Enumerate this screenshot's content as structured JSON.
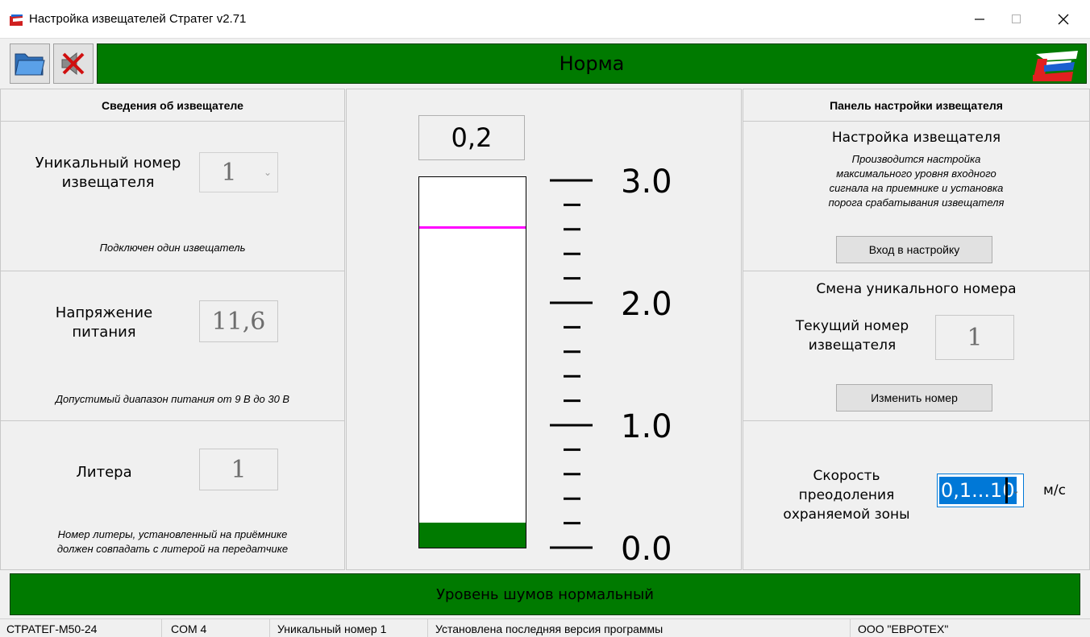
{
  "window": {
    "title": "Настройка извещателей Стратег v2.71"
  },
  "toolbar": {
    "status": "Норма",
    "status_color": "#007a00"
  },
  "left": {
    "header": "Сведения об извещателе",
    "unique": {
      "label": "Уникальный номер\nизвещателя",
      "value": "1",
      "note": "Подключен один извещатель"
    },
    "voltage": {
      "label": "Напряжение\nпитания",
      "value": "11,6",
      "note": "Допустимый диапазон питания от 9 В до 30 В"
    },
    "litera": {
      "label": "Литера",
      "value": "1",
      "note_line1": "Номер литеры, установленный на приёмнике",
      "note_line2": "должен совпадать с литерой на передатчике"
    }
  },
  "gauge": {
    "reading": "0,2",
    "level": 0.2,
    "threshold": 2.6,
    "max": 3.0,
    "scale_labels": [
      "3.0",
      "2.0",
      "1.0",
      "0.0"
    ],
    "fill_color": "#007a00",
    "threshold_color": "#ff00ff"
  },
  "right": {
    "header": "Панель настройки извещателя",
    "setup": {
      "title": "Настройка извещателя",
      "desc": "Производится настройка\nмаксимального уровня входного\nсигнала на приемнике и установка\nпорога срабатывания извещателя",
      "button": "Вход в настройку"
    },
    "change": {
      "title": "Смена уникального номера",
      "label": "Текущий номер\nизвещателя",
      "value": "1",
      "button": "Изменить номер"
    },
    "speed": {
      "label": "Скорость\nпреодоления\nохраняемой зоны",
      "value": "0,1...10",
      "unit": "м/с"
    }
  },
  "bottom": {
    "noise": "Уровень шумов нормальный"
  },
  "statusline": {
    "device": "СТРАТЕГ-М50-24",
    "port": "COM 4",
    "unique": "Уникальный номер 1",
    "version": "Установлена последняя версия программы",
    "company": "ООО \"ЕВРОТЕХ\""
  }
}
